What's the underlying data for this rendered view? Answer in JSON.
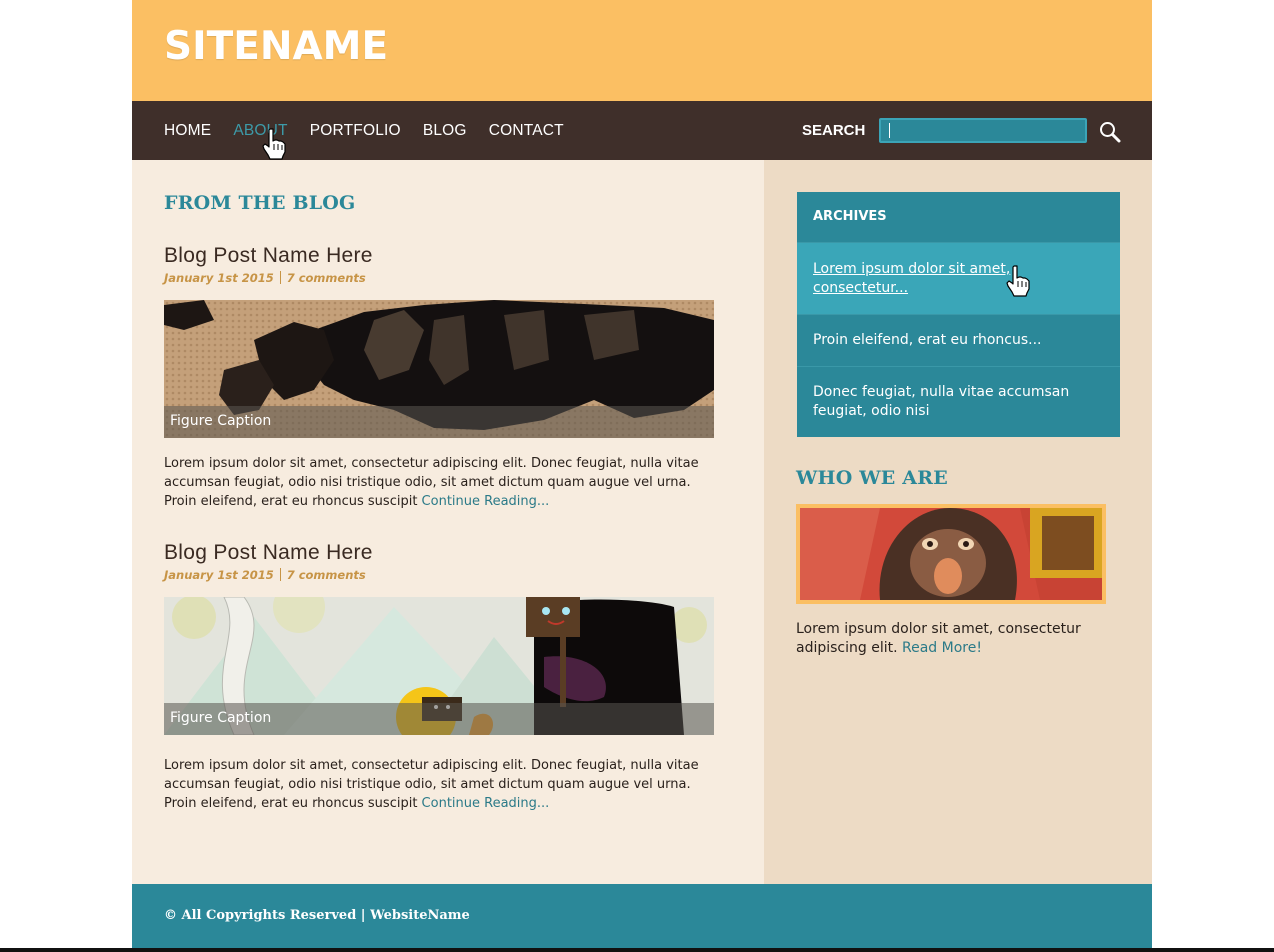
{
  "site": {
    "name": "SITENAME"
  },
  "nav": {
    "items": [
      {
        "label": "HOME",
        "active": false
      },
      {
        "label": "ABOUT",
        "active": true
      },
      {
        "label": "PORTFOLIO",
        "active": false
      },
      {
        "label": "BLOG",
        "active": false
      },
      {
        "label": "CONTACT",
        "active": false
      }
    ],
    "search_label": "SEARCH",
    "search_value": ""
  },
  "main": {
    "section_title": "FROM THE BLOG",
    "posts": [
      {
        "title": "Blog Post Name Here",
        "date": "January 1st 2015",
        "comments": "7 comments",
        "figure_caption": "Figure Caption",
        "body": "Lorem ipsum dolor sit amet, consectetur adipiscing elit. Donec feugiat, nulla vitae accumsan feugiat, odio nisi tristique odio, sit amet dictum quam augue vel urna. Proin eleifend, erat eu rhoncus suscipit ",
        "link": "Continue Reading..."
      },
      {
        "title": "Blog Post Name Here",
        "date": "January 1st 2015",
        "comments": "7 comments",
        "figure_caption": "Figure Caption",
        "body": "Lorem ipsum dolor sit amet, consectetur adipiscing elit. Donec feugiat, nulla vitae accumsan feugiat, odio nisi tristique odio, sit amet dictum quam augue vel urna. Proin eleifend, erat eu rhoncus suscipit ",
        "link": "Continue Reading..."
      }
    ]
  },
  "sidebar": {
    "archives": {
      "title": "ARCHIVES",
      "items": [
        {
          "label": "Lorem ipsum dolor sit amet, consectetur..."
        },
        {
          "label": "Proin eleifend, erat eu rhoncus..."
        },
        {
          "label": "Donec feugiat, nulla vitae accumsan feugiat, odio nisi"
        }
      ]
    },
    "who": {
      "title": "WHO WE ARE",
      "text": "Lorem ipsum dolor sit amet, consectetur adipiscing elit. ",
      "link": "Read More!"
    }
  },
  "footer": {
    "text": "© All Copyrights Reserved | WebsiteName"
  },
  "colors": {
    "header": "#fbbf63",
    "nav": "#3f2f2a",
    "teal": "#2b8899",
    "teal_hover": "#3aa6b8",
    "main_bg": "#f7ecdf",
    "sidebar_bg": "#eddbc5",
    "meta": "#c79446"
  },
  "icons": {
    "search": "magnifier-icon",
    "cursor": "hand-pointer-icon"
  }
}
